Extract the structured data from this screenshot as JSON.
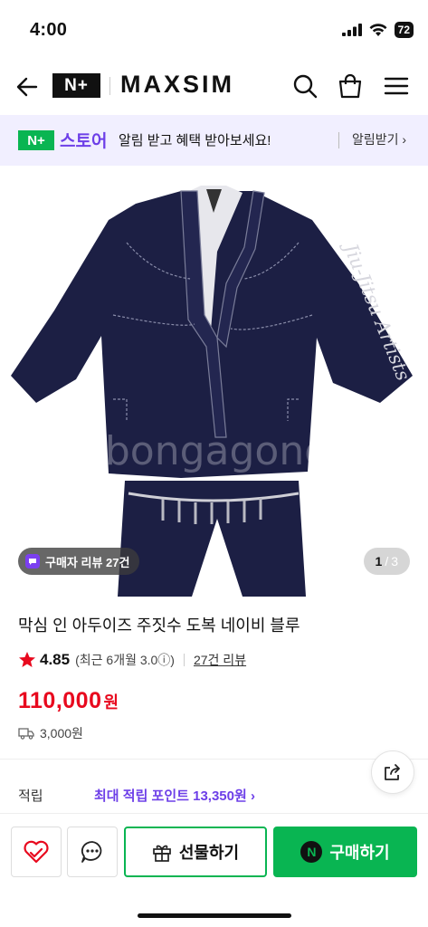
{
  "status": {
    "time": "4:00",
    "battery": "72"
  },
  "header": {
    "badge": "N+",
    "brand": "MAXSIM",
    "icons": [
      "back-arrow-icon",
      "search-icon",
      "shopping-bag-icon",
      "menu-icon"
    ]
  },
  "notice": {
    "badge": "N+",
    "store": "스토어",
    "message": "알림 받고 혜택 받아보세요!",
    "link": "알림받기 ›"
  },
  "gallery": {
    "review_pill": "구매자 리뷰 27건",
    "current": "1",
    "total": "3"
  },
  "product": {
    "title": "막심 인 아두이즈 주짓수 도복 네이비 블루",
    "rating": "4.85",
    "rating_detail": "(최근 6개월 3.0ⓘ)",
    "reviews_link": "27건 리뷰",
    "price": "110,000",
    "price_unit": "원",
    "shipping": "3,000원"
  },
  "points": {
    "label": "적립",
    "value": "최대 적립 포인트 13,350원 ›"
  },
  "bottom": {
    "gift_label": "선물하기",
    "buy_label": "구매하기",
    "buy_badge": "N"
  },
  "colors": {
    "accent_green": "#09b552",
    "accent_purple": "#6d3fe8",
    "price_red": "#e8091e",
    "navy_gi": "#1c1f44"
  }
}
